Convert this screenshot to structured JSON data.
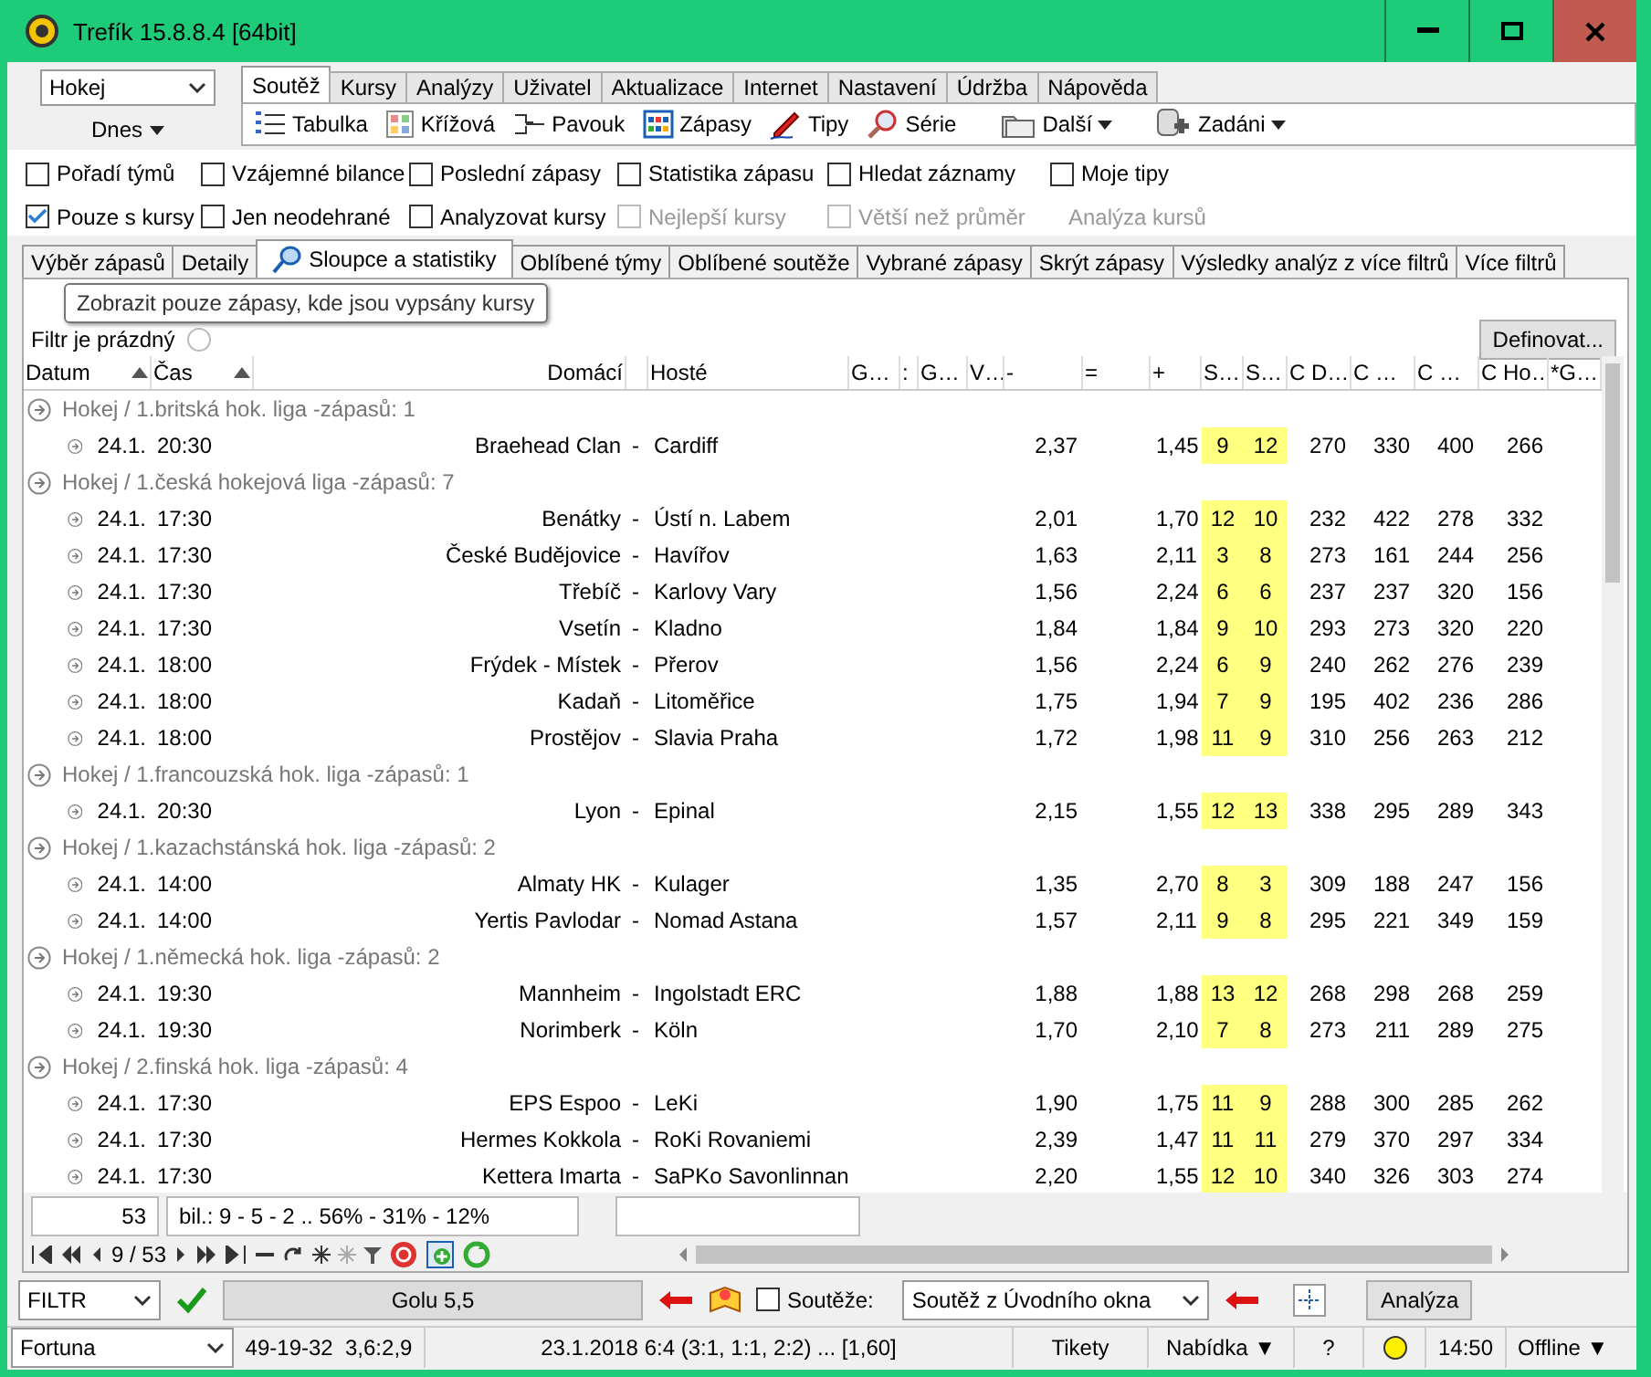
{
  "window": {
    "title": "Trefík 15.8.8.4 [64bit]"
  },
  "sport_select": {
    "value": "Hokej"
  },
  "day_button": {
    "label": "Dnes"
  },
  "main_tabs": [
    {
      "label": "Soutěž",
      "selected": true
    },
    {
      "label": "Kursy",
      "selected": false
    },
    {
      "label": "Analýzy",
      "selected": false
    },
    {
      "label": "Uživatel",
      "selected": false
    },
    {
      "label": "Aktualizace",
      "selected": false
    },
    {
      "label": "Internet",
      "selected": false
    },
    {
      "label": "Nastavení",
      "selected": false
    },
    {
      "label": "Údržba",
      "selected": false
    },
    {
      "label": "Nápověda",
      "selected": false
    }
  ],
  "toolbar": [
    {
      "label": "Tabulka",
      "kind": "list"
    },
    {
      "label": "Křížová",
      "kind": "grid"
    },
    {
      "label": "Pavouk",
      "kind": "bracket"
    },
    {
      "label": "Zápasy",
      "kind": "calendar"
    },
    {
      "label": "Tipy",
      "kind": "pencil"
    },
    {
      "label": "Série",
      "kind": "magnifier"
    },
    {
      "label": "Další",
      "kind": "folders",
      "dropdown": true
    },
    {
      "label": "Zadáni",
      "kind": "database",
      "dropdown": true
    }
  ],
  "options": [
    {
      "label": "Pořadí týmů",
      "kind": "checkbox",
      "checked": false,
      "disabled": false
    },
    {
      "label": "Vzájemné bilance",
      "kind": "checkbox",
      "checked": false,
      "disabled": false
    },
    {
      "label": "Poslední zápasy",
      "kind": "checkbox",
      "checked": false,
      "disabled": false
    },
    {
      "label": "Statistika zápasu",
      "kind": "checkbox",
      "checked": false,
      "disabled": false
    },
    {
      "label": "Hledat záznamy",
      "kind": "checkbox",
      "checked": false,
      "disabled": false
    },
    {
      "label": "Moje tipy",
      "kind": "checkbox",
      "checked": false,
      "disabled": false
    },
    {
      "label": "Pouze s kursy",
      "kind": "checkbox",
      "checked": true,
      "disabled": false
    },
    {
      "label": "Jen neodehrané",
      "kind": "checkbox",
      "checked": false,
      "disabled": false
    },
    {
      "label": "Analyzovat kursy",
      "kind": "checkbox",
      "checked": false,
      "disabled": false
    },
    {
      "label": "Nejlepší kursy",
      "kind": "checkbox",
      "checked": false,
      "disabled": true
    },
    {
      "label": "Větší než průměr",
      "kind": "checkbox",
      "checked": false,
      "disabled": true
    },
    {
      "label": "Analýza kursů",
      "kind": "label",
      "disabled": true
    }
  ],
  "sub_tabs": [
    {
      "label": "Výběr zápasů",
      "selected": false
    },
    {
      "label": "Detaily",
      "selected": false
    },
    {
      "label": "Sloupce a statistiky",
      "selected": true,
      "icon": true
    },
    {
      "label": "Oblíbené týmy",
      "selected": false
    },
    {
      "label": "Oblíbené soutěže",
      "selected": false
    },
    {
      "label": "Vybrané zápasy",
      "selected": false
    },
    {
      "label": "Skrýt zápasy",
      "selected": false
    },
    {
      "label": "Výsledky analýz z více filtrů",
      "selected": false
    },
    {
      "label": "Více filtrů",
      "selected": false
    }
  ],
  "tooltip": "Zobrazit pouze zápasy, kde jsou vypsány kursy",
  "filter": {
    "text": "Filtr je prázdný",
    "define_button": "Definovat..."
  },
  "table": {
    "columns": [
      {
        "label": "Datum",
        "sorted": true
      },
      {
        "label": "Čas",
        "sorted": true
      },
      {
        "label": "Domácí"
      },
      {},
      {
        "label": "Hosté"
      },
      {
        "label": "G…"
      },
      {
        "label": ":"
      },
      {
        "label": "G…"
      },
      {
        "label": "V…"
      },
      {
        "label": "-"
      },
      {
        "label": "="
      },
      {
        "label": "+"
      },
      {
        "label": "S…"
      },
      {
        "label": "S…"
      },
      {
        "label": "C D…"
      },
      {
        "label": "C …"
      },
      {
        "label": "C …"
      },
      {
        "label": "C Ho…"
      },
      {
        "label": "*G…"
      }
    ],
    "groups": [
      {
        "title": "Hokej / 1.britská hok. liga -zápasů: 1",
        "matches": [
          {
            "date": "24.1.",
            "time": "20:30",
            "home": "Braehead Clan",
            "sep": "-",
            "away": "Cardiff",
            "odds_home": "2,37",
            "odds_away": "1,45",
            "s1": "9",
            "s2": "12",
            "c": [
              "270",
              "330",
              "400",
              "266"
            ]
          }
        ]
      },
      {
        "title": "Hokej / 1.česká hokejová liga -zápasů: 7",
        "matches": [
          {
            "date": "24.1.",
            "time": "17:30",
            "home": "Benátky",
            "sep": "-",
            "away": "Ústí n. Labem",
            "odds_home": "2,01",
            "odds_away": "1,70",
            "s1": "12",
            "s2": "10",
            "c": [
              "232",
              "422",
              "278",
              "332"
            ]
          },
          {
            "date": "24.1.",
            "time": "17:30",
            "home": "České Budějovice",
            "sep": "-",
            "away": "Havířov",
            "odds_home": "1,63",
            "odds_away": "2,11",
            "s1": "3",
            "s2": "8",
            "c": [
              "273",
              "161",
              "244",
              "256"
            ]
          },
          {
            "date": "24.1.",
            "time": "17:30",
            "home": "Třebíč",
            "sep": "-",
            "away": "Karlovy Vary",
            "odds_home": "1,56",
            "odds_away": "2,24",
            "s1": "6",
            "s2": "6",
            "c": [
              "237",
              "237",
              "320",
              "156"
            ]
          },
          {
            "date": "24.1.",
            "time": "17:30",
            "home": "Vsetín",
            "sep": "-",
            "away": "Kladno",
            "odds_home": "1,84",
            "odds_away": "1,84",
            "s1": "9",
            "s2": "10",
            "c": [
              "293",
              "273",
              "320",
              "220"
            ]
          },
          {
            "date": "24.1.",
            "time": "18:00",
            "home": "Frýdek - Místek",
            "sep": "-",
            "away": "Přerov",
            "odds_home": "1,56",
            "odds_away": "2,24",
            "s1": "6",
            "s2": "9",
            "c": [
              "240",
              "262",
              "276",
              "239"
            ]
          },
          {
            "date": "24.1.",
            "time": "18:00",
            "home": "Kadaň",
            "sep": "-",
            "away": "Litoměřice",
            "odds_home": "1,75",
            "odds_away": "1,94",
            "s1": "7",
            "s2": "9",
            "c": [
              "195",
              "402",
              "236",
              "286"
            ]
          },
          {
            "date": "24.1.",
            "time": "18:00",
            "home": "Prostějov",
            "sep": "-",
            "away": "Slavia Praha",
            "odds_home": "1,72",
            "odds_away": "1,98",
            "s1": "11",
            "s2": "9",
            "c": [
              "310",
              "256",
              "263",
              "212"
            ]
          }
        ]
      },
      {
        "title": "Hokej / 1.francouzská hok. liga -zápasů: 1",
        "matches": [
          {
            "date": "24.1.",
            "time": "20:30",
            "home": "Lyon",
            "sep": "-",
            "away": "Epinal",
            "odds_home": "2,15",
            "odds_away": "1,55",
            "s1": "12",
            "s2": "13",
            "c": [
              "338",
              "295",
              "289",
              "343"
            ]
          }
        ]
      },
      {
        "title": "Hokej / 1.kazachstánská hok. liga -zápasů: 2",
        "matches": [
          {
            "date": "24.1.",
            "time": "14:00",
            "home": "Almaty HK",
            "sep": "-",
            "away": "Kulager",
            "odds_home": "1,35",
            "odds_away": "2,70",
            "s1": "8",
            "s2": "3",
            "c": [
              "309",
              "188",
              "247",
              "156"
            ]
          },
          {
            "date": "24.1.",
            "time": "14:00",
            "home": "Yertis Pavlodar",
            "sep": "-",
            "away": "Nomad Astana",
            "odds_home": "1,57",
            "odds_away": "2,11",
            "s1": "9",
            "s2": "8",
            "c": [
              "295",
              "221",
              "349",
              "159"
            ]
          }
        ]
      },
      {
        "title": "Hokej / 1.německá hok. liga -zápasů: 2",
        "matches": [
          {
            "date": "24.1.",
            "time": "19:30",
            "home": "Mannheim",
            "sep": "-",
            "away": "Ingolstadt ERC",
            "odds_home": "1,88",
            "odds_away": "1,88",
            "s1": "13",
            "s2": "12",
            "c": [
              "268",
              "298",
              "268",
              "259"
            ]
          },
          {
            "date": "24.1.",
            "time": "19:30",
            "home": "Norimberk",
            "sep": "-",
            "away": "Köln",
            "odds_home": "1,70",
            "odds_away": "2,10",
            "s1": "7",
            "s2": "8",
            "c": [
              "273",
              "211",
              "289",
              "275"
            ]
          }
        ]
      },
      {
        "title": "Hokej / 2.finská hok. liga -zápasů: 4",
        "matches": [
          {
            "date": "24.1.",
            "time": "17:30",
            "home": "EPS Espoo",
            "sep": "-",
            "away": "LeKi",
            "odds_home": "1,90",
            "odds_away": "1,75",
            "s1": "11",
            "s2": "9",
            "c": [
              "288",
              "300",
              "285",
              "262"
            ]
          },
          {
            "date": "24.1.",
            "time": "17:30",
            "home": "Hermes Kokkola",
            "sep": "-",
            "away": "RoKi Rovaniemi",
            "odds_home": "2,39",
            "odds_away": "1,47",
            "s1": "11",
            "s2": "11",
            "c": [
              "279",
              "370",
              "297",
              "334"
            ]
          },
          {
            "date": "24.1.",
            "time": "17:30",
            "home": "Kettera Imarta",
            "sep": "-",
            "away": "SaPKo Savonlinnan",
            "odds_home": "2,20",
            "odds_away": "1,55",
            "s1": "12",
            "s2": "10",
            "c": [
              "340",
              "326",
              "303",
              "274"
            ]
          }
        ]
      }
    ]
  },
  "summary": {
    "count": "53",
    "balance": "bil.: 9 - 5 - 2 .. 56% - 31% - 12%"
  },
  "navigator": {
    "position": "9 / 53"
  },
  "filter_bar": {
    "filter_select": "FILTR",
    "filter_button": "Golu 5,5",
    "competitions": {
      "label": "Soutěže:",
      "checked": false
    },
    "competition_select": "Soutěž z Úvodního okna",
    "analysis_button": "Analýza"
  },
  "status_bar": {
    "bookmaker": "Fortuna",
    "record": "49-19-32  3,6:2,9",
    "last_result": "23.1.2018 6:4 (3:1, 1:1, 2:2) ... [1,60]",
    "tickets": "Tikety",
    "offer": "Nabídka ▼",
    "help": "?",
    "time": "14:50",
    "mode": "Offline ▼"
  }
}
